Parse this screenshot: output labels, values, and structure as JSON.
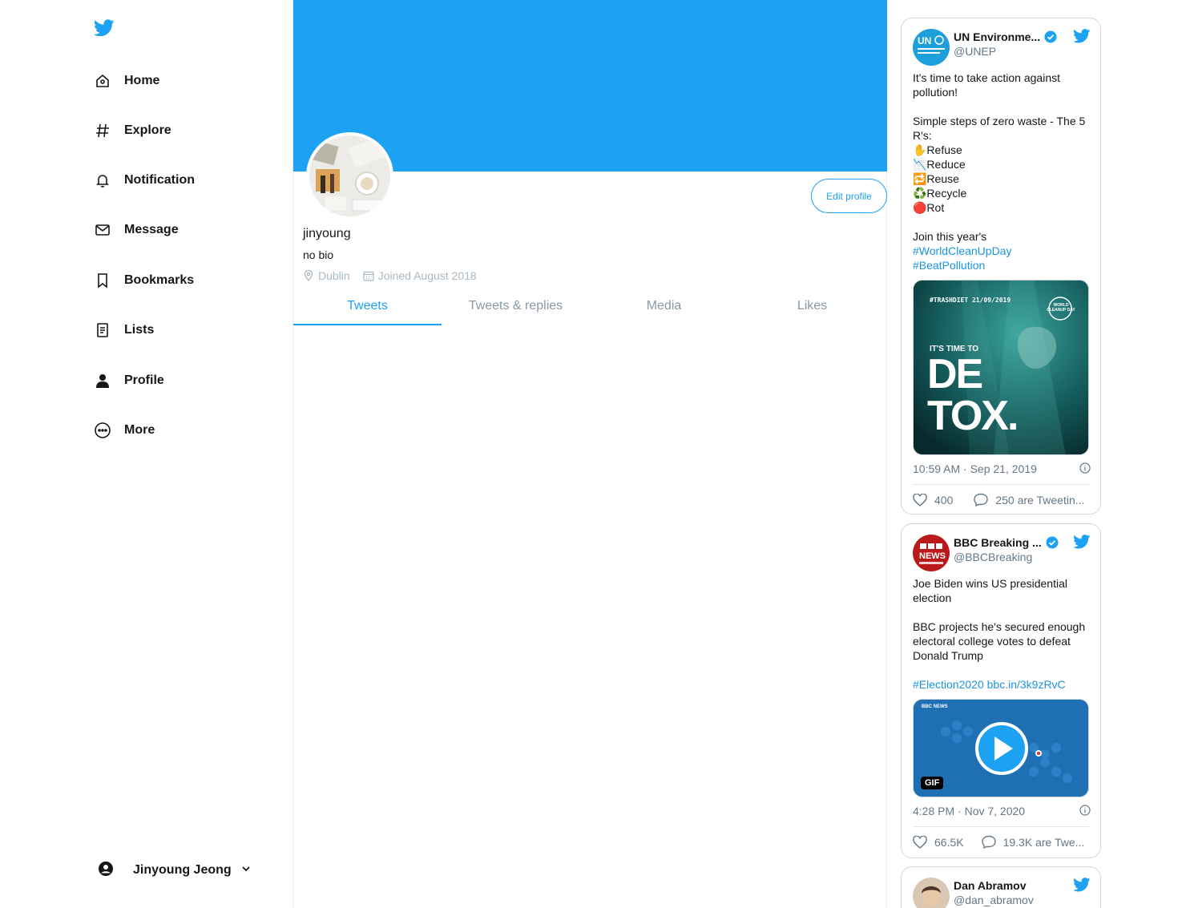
{
  "colors": {
    "accent": "#1da1f2",
    "text": "#14171a",
    "muted": "#657786",
    "verified": "#1da1f2"
  },
  "sidebar": {
    "logo_icon": "twitter-bird-icon",
    "items": [
      {
        "label": "Home",
        "icon": "home-icon"
      },
      {
        "label": "Explore",
        "icon": "hashtag-icon"
      },
      {
        "label": "Notification",
        "icon": "bell-icon"
      },
      {
        "label": "Message",
        "icon": "envelope-icon"
      },
      {
        "label": "Bookmarks",
        "icon": "bookmark-icon"
      },
      {
        "label": "Lists",
        "icon": "list-icon"
      },
      {
        "label": "Profile",
        "icon": "person-icon"
      },
      {
        "label": "More",
        "icon": "more-icon"
      }
    ],
    "account": {
      "name": "Jinyoung Jeong"
    }
  },
  "profile": {
    "edit_label": "Edit profile",
    "username": "jinyoung",
    "bio": "no bio",
    "location": "Dublin",
    "joined": "Joined August 2018",
    "tabs": [
      "Tweets",
      "Tweets & replies",
      "Media",
      "Likes"
    ]
  },
  "embeds": [
    {
      "name": "UN Environme...",
      "handle": "@UNEP",
      "text": "It's time to take action against pollution!\n\nSimple steps of zero waste - The 5 R's:\n✋Refuse\n📉Reduce\n🔁Reuse\n♻️Recycle\n🔴Rot\n\nJoin this year's",
      "hashtag1": "#WorldCleanUpDay",
      "hashtag2": "#BeatPollution",
      "image_text_top": "#TRASHDIET 21/09/2019",
      "image_text_sub": "IT'S TIME TO",
      "image_text_big1": "DE",
      "image_text_big2": "TOX.",
      "image_badge": "WORLD CLEANUP DAY",
      "timestamp": "10:59 AM · Sep 21, 2019",
      "likes": "400",
      "replies": "250 are Tweetin..."
    },
    {
      "name": "BBC Breaking ...",
      "handle": "@BBCBreaking",
      "text": "Joe Biden wins US presidential election\n\nBBC projects he's secured enough electoral college votes to defeat Donald Trump",
      "links": "#Election2020 bbc.in/3k9zRvC",
      "media_brand": "BBC NEWS",
      "gif_badge": "GIF",
      "timestamp": "4:28 PM · Nov 7, 2020",
      "likes": "66.5K",
      "replies": "19.3K are Twe..."
    },
    {
      "name": "Dan Abramov",
      "handle": "@dan_abramov"
    }
  ]
}
